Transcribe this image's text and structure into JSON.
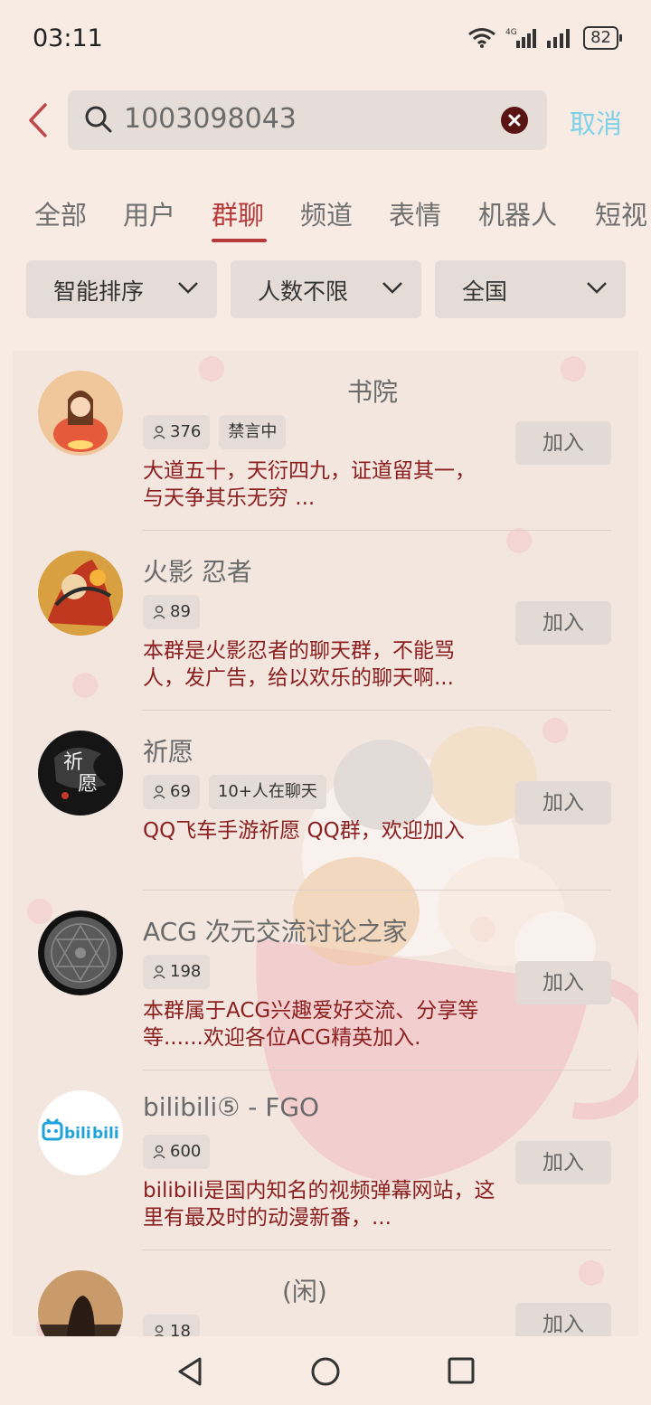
{
  "status": {
    "time": "03:11",
    "battery": "82",
    "network": "4G"
  },
  "search": {
    "query": "1003098043",
    "cancel_label": "取消"
  },
  "tabs": [
    {
      "label": "全部"
    },
    {
      "label": "用户"
    },
    {
      "label": "群聊"
    },
    {
      "label": "频道"
    },
    {
      "label": "表情"
    },
    {
      "label": "机器人"
    },
    {
      "label": "短视"
    }
  ],
  "active_tab": "群聊",
  "filters": [
    {
      "label": "智能排序"
    },
    {
      "label": "人数不限"
    },
    {
      "label": "全国"
    }
  ],
  "groups": [
    {
      "name": "书院",
      "members": "376",
      "badge": "禁言中",
      "desc": "大道五十，天衍四九，证道留其一，与天争其乐无穷 ...",
      "join": "加入"
    },
    {
      "name": "火影  忍者",
      "members": "89",
      "badge": "",
      "desc": "本群是火影忍者的聊天群，不能骂人，发广告，给以欢乐的聊天啊...",
      "join": "加入"
    },
    {
      "name": "祈愿",
      "members": "69",
      "badge": "10+人在聊天",
      "desc": "QQ飞车手游祈愿      QQ群，欢迎加入",
      "join": "加入"
    },
    {
      "name": "ACG  次元交流讨论之家",
      "members": "198",
      "badge": "",
      "desc": "本群属于ACG兴趣爱好交流、分享等等......欢迎各位ACG精英加入.",
      "join": "加入"
    },
    {
      "name": "bilibili⑤ - FGO",
      "members": "600",
      "badge": "",
      "desc": "bilibili是国内知名的视频弹幕网站，这里有最及时的动漫新番，...",
      "join": "加入"
    },
    {
      "name": "(闲)",
      "members": "18",
      "badge": "",
      "desc": "",
      "join": "加入"
    }
  ],
  "colors": {
    "accent": "#b73a3a",
    "cancel": "#7fd1e8",
    "desc_text": "#8b1e1e"
  }
}
